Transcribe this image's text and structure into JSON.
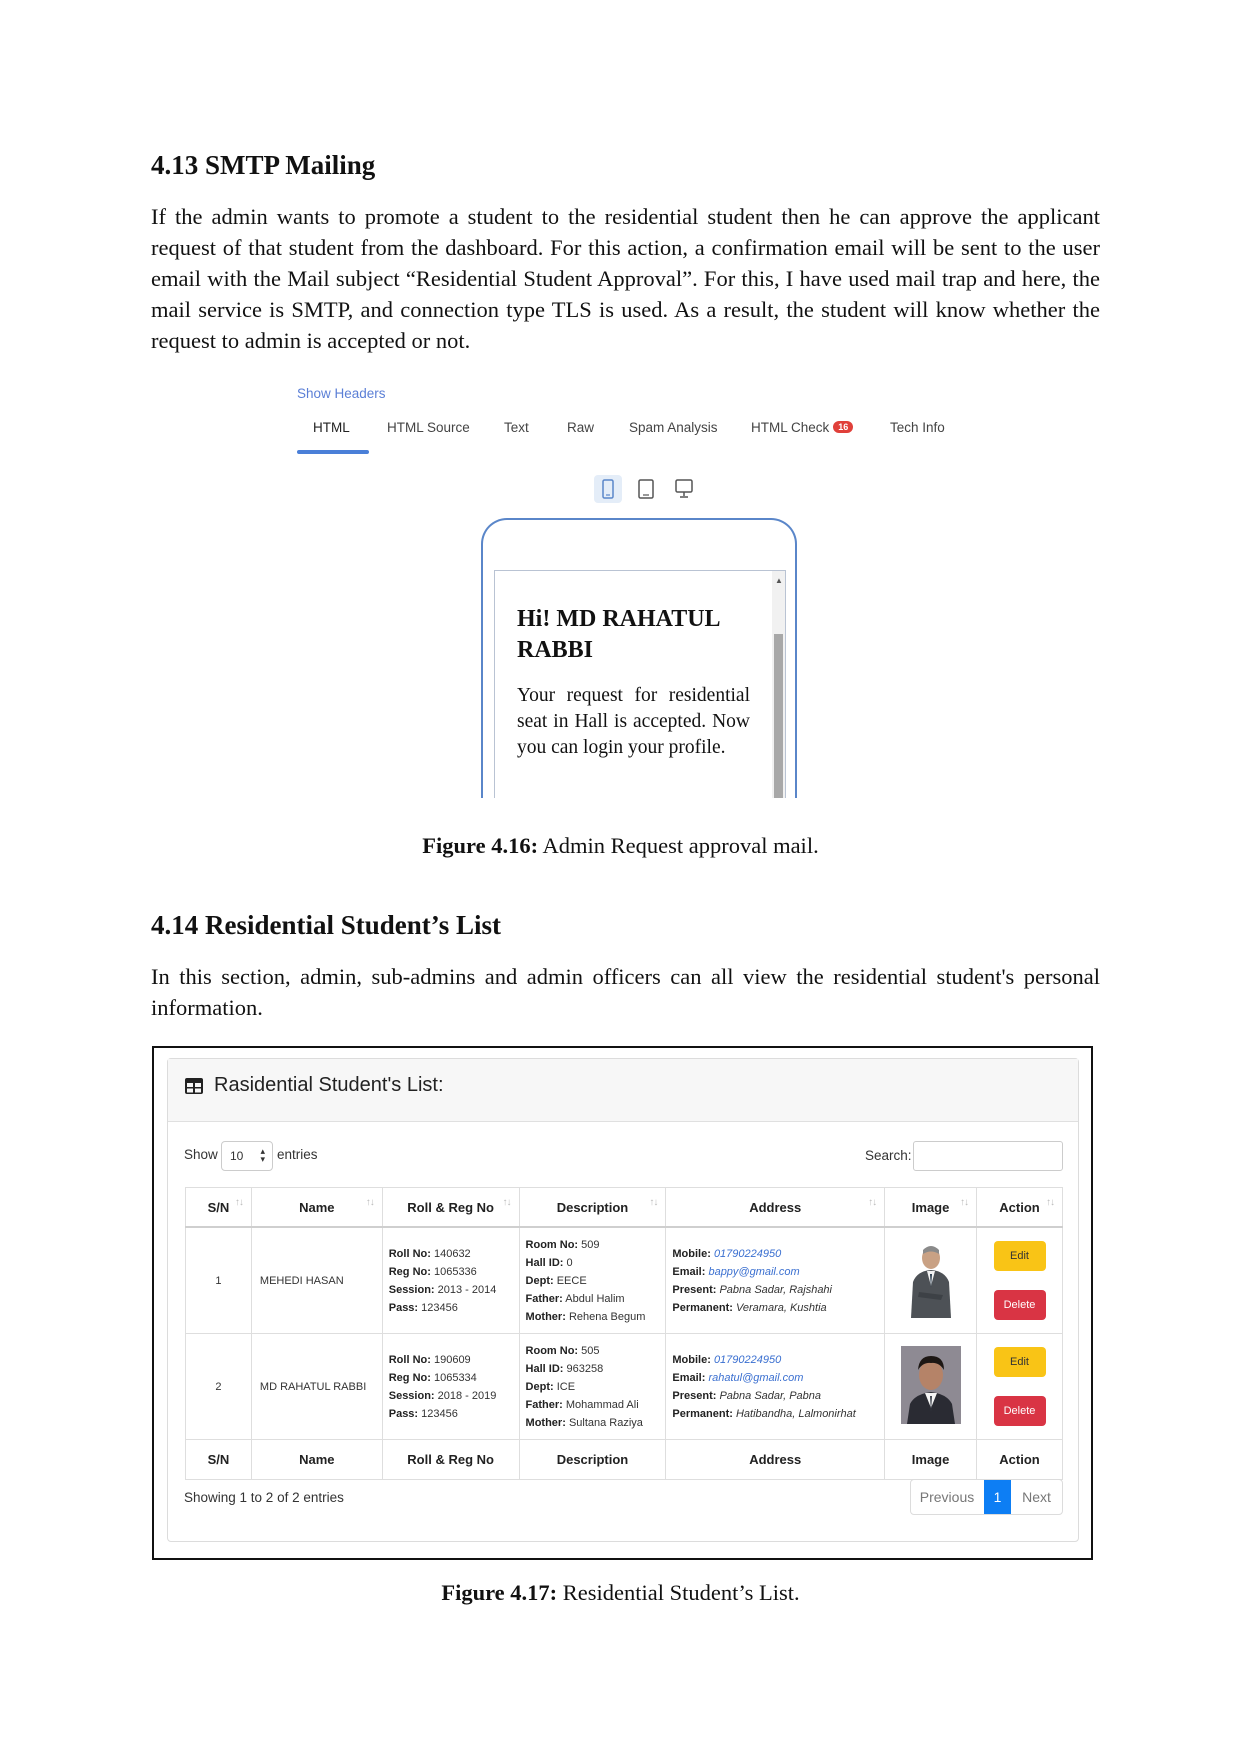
{
  "section_4_13": {
    "heading": "4.13 SMTP Mailing",
    "paragraph": "If the admin wants to promote a student to the residential student then he can approve the applicant request of that student from the dashboard. For this action, a confirmation email will be sent to the user email with the Mail subject “Residential Student Approval”. For this, I have used mail trap and here, the mail service is SMTP, and connection type TLS is used. As a result, the student will know whether the request to admin is accepted or not."
  },
  "mail_preview": {
    "show_headers": "Show Headers",
    "tabs": [
      "HTML",
      "HTML Source",
      "Text",
      "Raw",
      "Spam Analysis",
      "HTML Check",
      "Tech Info"
    ],
    "html_check_badge": "16",
    "active_tab": "HTML",
    "device_icons": [
      "mobile-icon",
      "tablet-icon",
      "desktop-icon"
    ],
    "greeting": "Hi! MD RAHATUL RABBI",
    "body": "Your request for residential seat in Hall is accepted. Now you can login your profile."
  },
  "figure_4_16": {
    "label": "Figure 4.16:",
    "text": " Admin Request approval mail."
  },
  "section_4_14": {
    "heading": "4.14 Residential Student’s List",
    "paragraph": "In this section, admin, sub-admins and admin officers can all view the residential student's personal information."
  },
  "student_list": {
    "title": "Rasidential Student's List:",
    "show_label": "Show",
    "show_value": "10",
    "entries_label": "entries",
    "search_label": "Search:",
    "columns": [
      "S/N",
      "Name",
      "Roll & Reg No",
      "Description",
      "Address",
      "Image",
      "Action"
    ],
    "rows": [
      {
        "sn": "1",
        "name": "MEHEDI HASAN",
        "roll": "140632",
        "reg": "1065336",
        "session": "2013 - 2014",
        "pass": "123456",
        "room": "509",
        "hall_id": "0",
        "dept": "EECE",
        "father": "Abdul Halim",
        "mother": "Rehena Begum",
        "mobile": "01790224950",
        "email": "bappy@gmail.com",
        "present": "Pabna Sadar, Rajshahi",
        "permanent": "Veramara, Kushtia",
        "edit": "Edit",
        "delete": "Delete"
      },
      {
        "sn": "2",
        "name": "MD RAHATUL RABBI",
        "roll": "190609",
        "reg": "1065334",
        "session": "2018 - 2019",
        "pass": "123456",
        "room": "505",
        "hall_id": "963258",
        "dept": "ICE",
        "father": "Mohammad Ali",
        "mother": "Sultana Raziya",
        "mobile": "01790224950",
        "email": "rahatul@gmail.com",
        "present": "Pabna Sadar, Pabna",
        "permanent": "Hatibandha, Lalmonirhat",
        "edit": "Edit",
        "delete": "Delete"
      }
    ],
    "field_labels": {
      "roll": "Roll No:",
      "reg": "Reg No:",
      "session": "Session:",
      "pass": "Pass:",
      "room": "Room No:",
      "hall_id": "Hall ID:",
      "dept": "Dept:",
      "father": "Father:",
      "mother": "Mother:",
      "mobile": "Mobile:",
      "email": "Email:",
      "present": "Present:",
      "permanent": "Permanent:"
    },
    "footer_info": "Showing 1 to 2 of 2 entries",
    "pagination": {
      "previous": "Previous",
      "current": "1",
      "next": "Next"
    },
    "colors": {
      "edit": "#f9c416",
      "delete": "#d93444",
      "active_page": "#0d7ef4"
    }
  },
  "figure_4_17": {
    "label": "Figure 4.17:",
    "text": " Residential Student’s List."
  }
}
